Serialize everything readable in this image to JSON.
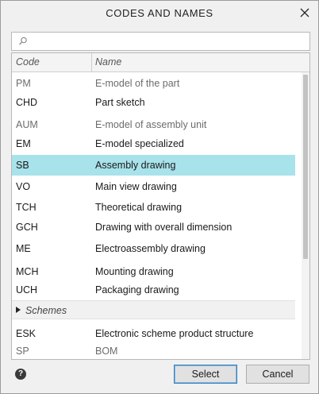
{
  "window": {
    "title": "CODES AND NAMES"
  },
  "search": {
    "value": "",
    "placeholder": ""
  },
  "table": {
    "headers": {
      "code": "Code",
      "name": "Name"
    },
    "rows": [
      {
        "code": "PM",
        "name": "E-model of the part",
        "muted": true
      },
      {
        "code": "CHD",
        "name": "Part sketch",
        "muted": false
      },
      {
        "code": "AUM",
        "name": "E-model of assembly unit",
        "muted": true
      },
      {
        "code": "EM",
        "name": "E-model specialized",
        "muted": false
      },
      {
        "code": "SB",
        "name": "Assembly drawing",
        "muted": false,
        "selected": true
      },
      {
        "code": "VO",
        "name": "Main view drawing",
        "muted": false
      },
      {
        "code": "TCH",
        "name": "Theoretical drawing",
        "muted": false
      },
      {
        "code": "GCH",
        "name": "Drawing with overall dimension",
        "muted": false
      },
      {
        "code": "ME",
        "name": "Electroassembly drawing",
        "muted": false
      },
      {
        "code": "MCH",
        "name": "Mounting drawing",
        "muted": false
      },
      {
        "code": "UCH",
        "name": "Packaging drawing",
        "muted": false
      }
    ],
    "group": {
      "label": "Schemes",
      "expanded": false
    },
    "rows_after_group": [
      {
        "code": "ESK",
        "name": "Electronic scheme product structure",
        "muted": false
      },
      {
        "code": "SP",
        "name": "BOM",
        "muted": true
      }
    ]
  },
  "footer": {
    "help_glyph": "?",
    "select_label": "Select",
    "cancel_label": "Cancel"
  },
  "colors": {
    "selected_row": "#a8e2ea",
    "primary_button_border": "#3c7fb1"
  },
  "icons": {
    "close": "close-icon",
    "search": "search-icon",
    "help": "help-icon",
    "expand": "triangle-right-icon"
  }
}
